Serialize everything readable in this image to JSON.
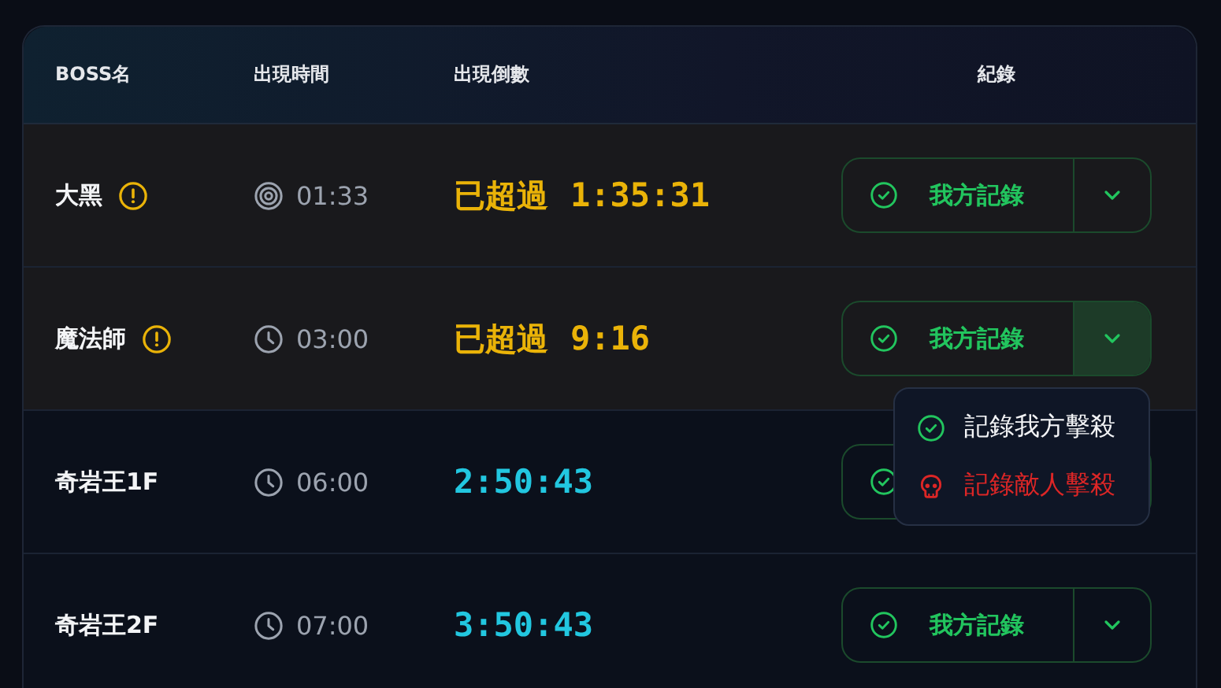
{
  "table": {
    "columns": [
      "BOSS名",
      "出現時間",
      "出現倒數",
      "紀錄"
    ],
    "rows": [
      {
        "name": "大黑",
        "overdue": true,
        "time": {
          "kind": "target",
          "value": "01:33"
        },
        "overdue_label": "已超過",
        "countdown": "1:35:31",
        "record_label": "我方記錄",
        "menu_open": false
      },
      {
        "name": "魔法師",
        "overdue": true,
        "time": {
          "kind": "clock",
          "value": "03:00"
        },
        "overdue_label": "已超過",
        "countdown": "9:16",
        "record_label": "我方記錄",
        "menu_open": true
      },
      {
        "name": "奇岩王1F",
        "overdue": false,
        "time": {
          "kind": "clock",
          "value": "06:00"
        },
        "countdown": "2:50:43",
        "menu_open": false
      },
      {
        "name": "奇岩王2F",
        "overdue": false,
        "time": {
          "kind": "clock",
          "value": "07:00"
        },
        "countdown": "3:50:43",
        "record_label": "我方記錄",
        "menu_open": false
      }
    ]
  },
  "record_menu": [
    {
      "kind": "ours",
      "label": "記錄我方擊殺"
    },
    {
      "kind": "enemy",
      "label": "記錄敵人擊殺"
    }
  ]
}
